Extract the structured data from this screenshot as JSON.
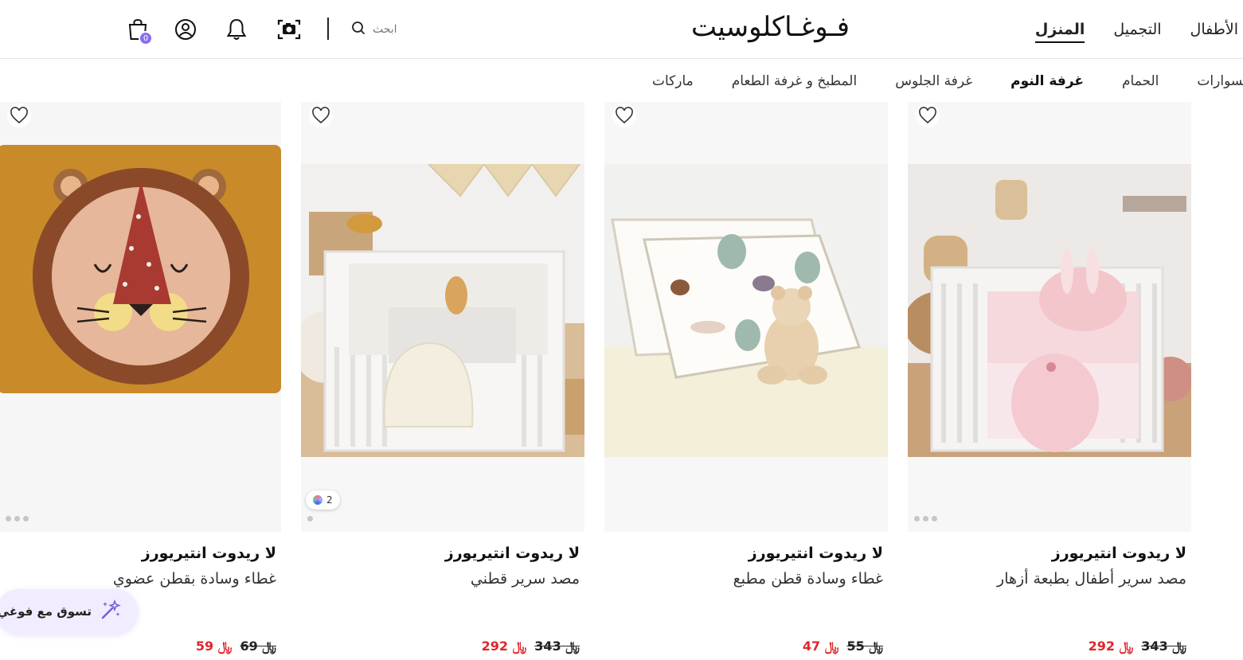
{
  "header": {
    "logo": "فـوغـاكلوسيت",
    "tabs": [
      {
        "label": "الأطفال",
        "active": false
      },
      {
        "label": "التجميل",
        "active": false
      },
      {
        "label": "المنزل",
        "active": true
      }
    ],
    "search_placeholder": "ابحث",
    "cart_count": "0"
  },
  "subnav": {
    "items": [
      {
        "label": "اكسسوارات",
        "active": false
      },
      {
        "label": "الحمام",
        "active": false
      },
      {
        "label": "غرفة النوم",
        "active": true
      },
      {
        "label": "غرفة الجلوس",
        "active": false
      },
      {
        "label": "المطبخ و غرفة الطعام",
        "active": false
      },
      {
        "label": "ماركات",
        "active": false
      }
    ]
  },
  "products": [
    {
      "brand": "لا ريدوت انتيريورز",
      "name": "مصد سرير أطفال بطبعة أزهار",
      "old_price": "343",
      "new_price": "292",
      "currency": "﷼"
    },
    {
      "brand": "لا ريدوت انتيريورز",
      "name": "غطاء وسادة قطن مطبع",
      "old_price": "55",
      "new_price": "47",
      "currency": "﷼"
    },
    {
      "brand": "لا ريدوت انتيريورز",
      "name": "مصد سرير قطني",
      "old_price": "343",
      "new_price": "292",
      "currency": "﷼",
      "colors_count": "2"
    },
    {
      "brand": "لا ريدوت انتيريورز",
      "name": "غطاء وسادة بقطن عضوي",
      "old_price": "69",
      "new_price": "59",
      "currency": "﷼"
    }
  ],
  "ai_assistant": {
    "label": "تسوق مع فوغي"
  },
  "colors": {
    "accent": "#8a6cf0",
    "sale": "#e0262c",
    "ai_bg": "#f1ecff"
  }
}
